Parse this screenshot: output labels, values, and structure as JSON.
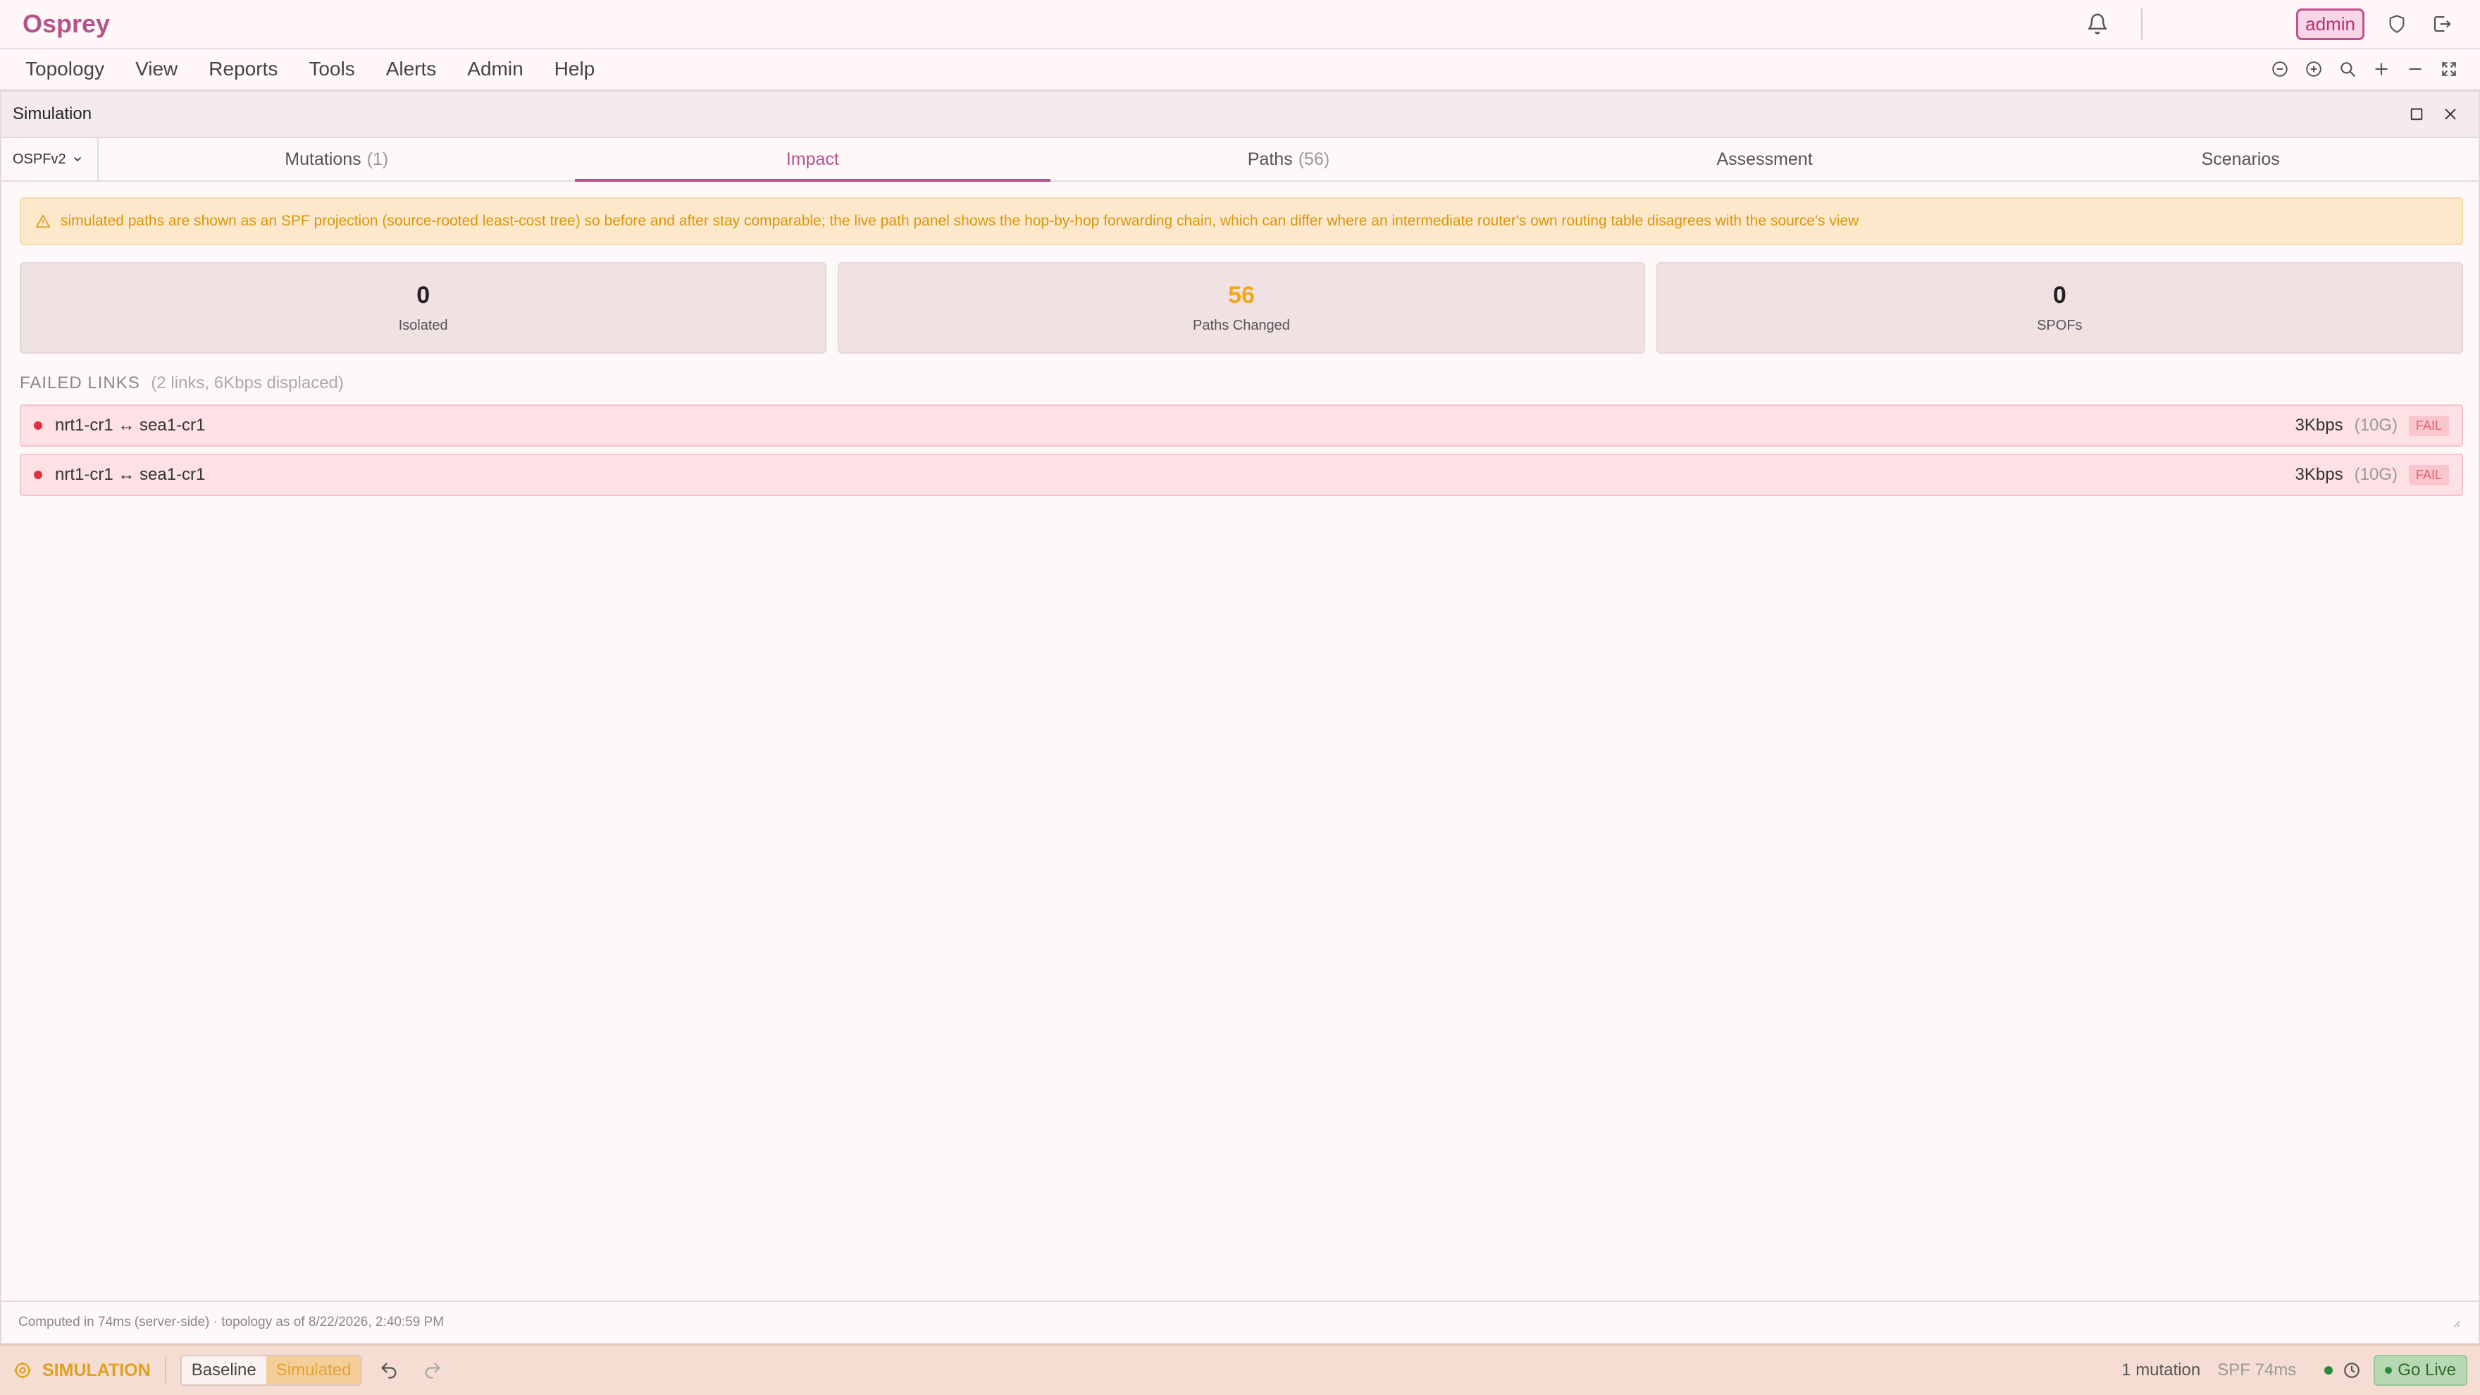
{
  "app": {
    "title": "Osprey",
    "user": "admin"
  },
  "menu": {
    "items": [
      "Topology",
      "View",
      "Reports",
      "Tools",
      "Alerts",
      "Admin",
      "Help"
    ]
  },
  "panel": {
    "title": "Simulation",
    "protocol": "OSPFv2",
    "tabs": [
      {
        "label": "Mutations",
        "count": "(1)"
      },
      {
        "label": "Impact",
        "count": ""
      },
      {
        "label": "Paths",
        "count": "(56)"
      },
      {
        "label": "Assessment",
        "count": ""
      },
      {
        "label": "Scenarios",
        "count": ""
      }
    ],
    "active_tab": "Impact"
  },
  "impact": {
    "warning": "simulated paths are shown as an SPF projection (source-rooted least-cost tree) so before and after stay comparable; the live path panel shows the hop-by-hop forwarding chain, which can differ where an intermediate router's own routing table disagrees with the source's view",
    "stats": [
      {
        "value": "0",
        "label": "Isolated"
      },
      {
        "value": "56",
        "label": "Paths Changed"
      },
      {
        "value": "0",
        "label": "SPOFs"
      }
    ],
    "failed_links": {
      "title": "FAILED LINKS",
      "summary": "(2 links, 6Kbps displaced)",
      "rows": [
        {
          "link": "nrt1-cr1 ↔ sea1-cr1",
          "traffic": "3Kbps",
          "capacity": "(10G)",
          "status": "FAIL"
        },
        {
          "link": "nrt1-cr1 ↔ sea1-cr1",
          "traffic": "3Kbps",
          "capacity": "(10G)",
          "status": "FAIL"
        }
      ]
    }
  },
  "footer": {
    "text": "Computed in 74ms (server-side) · topology as of 8/22/2026, 2:40:59 PM"
  },
  "statusbar": {
    "mode": "SIMULATION",
    "baseline_label": "Baseline",
    "simulated_label": "Simulated",
    "mutation_count": "1 mutation",
    "spf": "SPF 74ms",
    "go_live": "Go Live"
  },
  "colors": {
    "accent": "#b4548a",
    "warning": "#f0a81e",
    "fail": "#e0303f",
    "live": "#2e8b3e"
  }
}
